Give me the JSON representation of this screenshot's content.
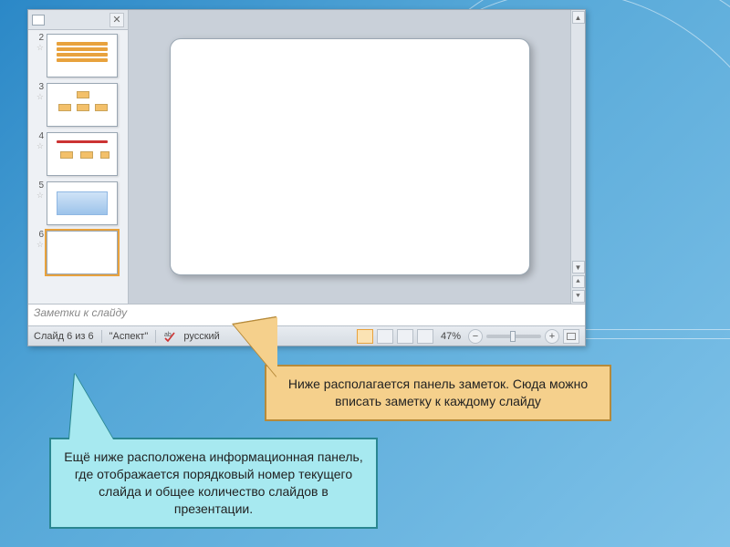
{
  "thumbs": {
    "items": [
      {
        "num": "2"
      },
      {
        "num": "3"
      },
      {
        "num": "4"
      },
      {
        "num": "5"
      },
      {
        "num": "6"
      }
    ],
    "star": "☆"
  },
  "notes": {
    "placeholder": "Заметки к слайду"
  },
  "status": {
    "slide_counter": "Слайд 6 из 6",
    "theme": "\"Аспект\"",
    "language": "русский",
    "zoom": "47%"
  },
  "callouts": {
    "orange": "Ниже располагается панель заметок. Сюда можно вписать заметку к каждому слайду",
    "cyan": "Ещё ниже расположена информационная панель, где отображается порядковый номер текущего слайда и общее количество слайдов в презентации."
  }
}
